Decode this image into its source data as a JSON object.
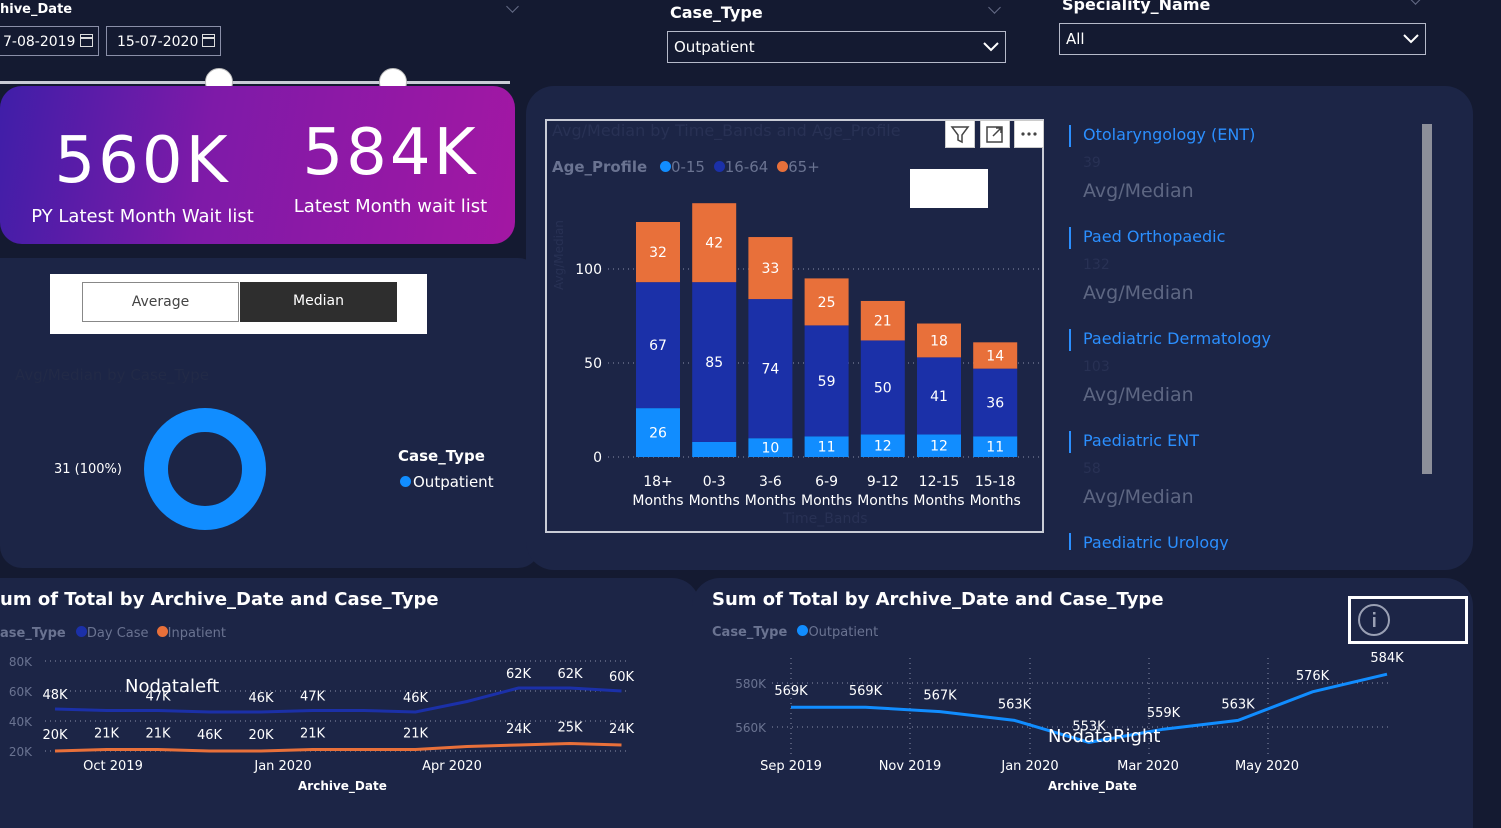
{
  "filters": {
    "archive_date": {
      "title": "hive_Date",
      "start": "7-08-2019",
      "end": "15-07-2020",
      "range": [
        0.43,
        0.77
      ]
    },
    "case_type": {
      "title": "Case_Type",
      "value": "Outpatient"
    },
    "speciality": {
      "title": "Speciality_Name",
      "value": "All"
    }
  },
  "kpis": {
    "py": {
      "value": "560K",
      "label": "PY Latest Month Wait list"
    },
    "latest": {
      "value": "584K",
      "label": "Latest Month wait list"
    }
  },
  "toggle": {
    "average": "Average",
    "median": "Median",
    "selected": "median"
  },
  "donut": {
    "hidden_title": "Avg/Median by Case_Type",
    "label": "31 (100%)",
    "legend_title": "Case_Type",
    "legend_item": "Outpatient",
    "color": "#118dff"
  },
  "bar_chart": {
    "hidden_title": "Avg/Median by Time_Bands and Age_Profile",
    "legend_title": "Age_Profile",
    "legend_items": [
      {
        "name": "0-15",
        "color": "#118dff"
      },
      {
        "name": "16-64",
        "color": "#1b30a8"
      },
      {
        "name": "65+",
        "color": "#e8703a"
      }
    ],
    "hidden_ylabel": "Avg/Median",
    "hidden_xlabel": "Time_Bands"
  },
  "chart_data": [
    {
      "type": "bar",
      "stacked": true,
      "categories": [
        "18+ Months",
        "0-3 Months",
        "3-6 Months",
        "6-9 Months",
        "9-12 Months",
        "12-15 Months",
        "15-18 Months"
      ],
      "series": [
        {
          "name": "0-15",
          "values": [
            26,
            8,
            10,
            11,
            12,
            12,
            11
          ],
          "color": "#118dff",
          "labels": [
            "26",
            "",
            "10",
            "11",
            "12",
            "12",
            "11"
          ]
        },
        {
          "name": "16-64",
          "values": [
            67,
            85,
            74,
            59,
            50,
            41,
            36
          ],
          "color": "#1b30a8"
        },
        {
          "name": "65+",
          "values": [
            32,
            42,
            33,
            25,
            21,
            18,
            14
          ],
          "color": "#e8703a"
        }
      ],
      "yticks": [
        0,
        50,
        100
      ],
      "ylim": [
        0,
        140
      ],
      "grid": true
    },
    {
      "type": "line",
      "title": "um of Total by Archive_Date and Case_Type",
      "legend_title": "ase_Type",
      "series": [
        {
          "name": "Day Case",
          "color": "#1b30a8",
          "values": [
            48,
            47,
            47,
            46,
            46,
            47,
            47,
            46,
            53,
            62,
            62,
            60
          ],
          "labels": [
            "48K",
            "",
            "47K",
            "",
            "46K",
            "47K",
            "",
            "46K",
            "",
            "62K",
            "62K",
            "60K"
          ]
        },
        {
          "name": "Inpatient",
          "color": "#e8703a",
          "values": [
            20,
            21,
            21,
            20,
            20,
            21,
            21,
            21,
            23,
            24,
            25,
            24
          ],
          "labels": [
            "20K",
            "21K",
            "21K",
            "46K",
            "20K",
            "21K",
            "",
            "21K",
            "",
            "24K",
            "25K",
            "24K"
          ]
        }
      ],
      "yticks": [
        "20K",
        "40K",
        "60K",
        "80K"
      ],
      "xticks": [
        "Oct 2019",
        "Jan 2020",
        "Apr 2020"
      ],
      "xlabel": "Archive_Date",
      "overlay_text": "Nodataleft"
    },
    {
      "type": "line",
      "title": "Sum of Total by Archive_Date and Case_Type",
      "legend_title": "Case_Type",
      "series": [
        {
          "name": "Outpatient",
          "color": "#118dff",
          "values": [
            569,
            569,
            567,
            563,
            553,
            559,
            563,
            576,
            584
          ],
          "labels": [
            "569K",
            "569K",
            "567K",
            "563K",
            "553K",
            "559K",
            "563K",
            "576K",
            "584K"
          ]
        }
      ],
      "yticks": [
        "560K",
        "580K"
      ],
      "xticks": [
        "Sep 2019",
        "Nov 2019",
        "Jan 2020",
        "Mar 2020",
        "May 2020"
      ],
      "xlabel": "Archive_Date",
      "overlay_text": "NodataRight"
    }
  ],
  "specialities": [
    {
      "name": "Otolaryngology (ENT)",
      "value": "39",
      "sub": "Avg/Median"
    },
    {
      "name": "Paed Orthopaedic",
      "value": "132",
      "sub": "Avg/Median"
    },
    {
      "name": "Paediatric Dermatology",
      "value": "103",
      "sub": "Avg/Median"
    },
    {
      "name": "Paediatric ENT",
      "value": "58",
      "sub": "Avg/Median"
    },
    {
      "name": "Paediatric Urology",
      "value": "",
      "sub": ""
    }
  ]
}
